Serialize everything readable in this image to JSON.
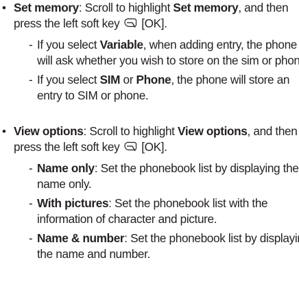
{
  "bullets": [
    {
      "title": "Set memory",
      "intro_pre": ": Scroll to highlight ",
      "intro_bold": "Set memory",
      "intro_post": ", and then press the left soft key",
      "key_label": " [OK].",
      "subitems": [
        {
          "dash": "-",
          "t1": "If you select ",
          "b1": "Variable",
          "t2": ", when adding entry, the phone will ask whether you wish to store on the sim or phone.",
          "b2": "",
          "t3": ""
        },
        {
          "dash": "-",
          "t1": "If you select ",
          "b1": "SIM",
          "t2": " or ",
          "b2": "Phone",
          "t3": ", the phone will store an entry to SIM or phone."
        }
      ]
    },
    {
      "title": "View options",
      "intro_pre": ": Scroll to highlight ",
      "intro_bold": "View options",
      "intro_post": ", and then press the left soft key",
      "key_label": " [OK].",
      "subitems": [
        {
          "dash": "-",
          "b1": "Name only",
          "t1": ": Set the phonebook list by displaying the name only."
        },
        {
          "dash": "-",
          "b1": "With pictures",
          "t1": ": Set the phonebook list with the information of character and picture."
        },
        {
          "dash": "-",
          "b1": "Name & number",
          "t1": ": Set the phonebook list by displaying the name and number."
        }
      ]
    }
  ],
  "icons": {
    "softkey": "left-soft-key-icon"
  }
}
